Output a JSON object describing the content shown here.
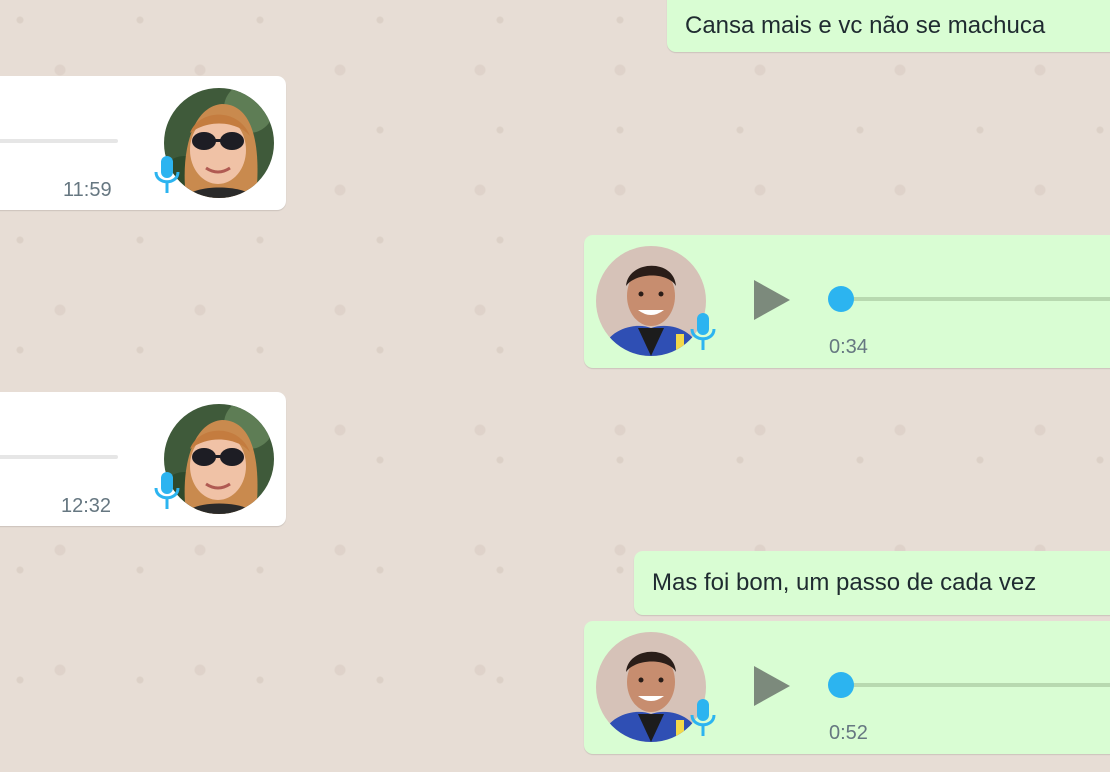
{
  "colors": {
    "background": "#e7ddd5",
    "outgoing_bubble": "#d9fdd3",
    "incoming_bubble": "#ffffff",
    "accent_blue": "#2cb4f0",
    "play_icon": "#7c8a7c",
    "meta_text": "#667781"
  },
  "messages": [
    {
      "type": "text",
      "direction": "outgoing",
      "text": "Cansa mais e vc não se machuca"
    },
    {
      "type": "voice",
      "direction": "incoming",
      "time": "11:59",
      "sender_avatar": "avatar-woman-sunglasses",
      "icon": "microphone-icon"
    },
    {
      "type": "voice",
      "direction": "outgoing",
      "duration": "0:34",
      "sender_avatar": "avatar-man-blue-gi",
      "icon": "microphone-icon",
      "progress": 0
    },
    {
      "type": "voice",
      "direction": "incoming",
      "time": "12:32",
      "sender_avatar": "avatar-woman-sunglasses",
      "icon": "microphone-icon"
    },
    {
      "type": "text",
      "direction": "outgoing",
      "text": "Mas foi bom, um passo de cada vez"
    },
    {
      "type": "voice",
      "direction": "outgoing",
      "duration": "0:52",
      "sender_avatar": "avatar-man-blue-gi",
      "icon": "microphone-icon",
      "progress": 0
    }
  ]
}
